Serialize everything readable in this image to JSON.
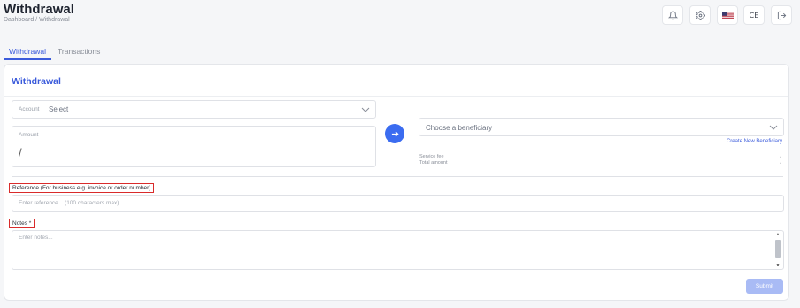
{
  "header": {
    "title": "Withdrawal",
    "breadcrumb": "Dashboard / Withdrawal",
    "lang_code": "CE",
    "icons": [
      "bell-icon",
      "gear-icon",
      "us-flag-icon",
      "language-icon",
      "logout-icon"
    ]
  },
  "tabs": [
    {
      "label": "Withdrawal",
      "active": true
    },
    {
      "label": "Transactions",
      "active": false
    }
  ],
  "form": {
    "title": "Withdrawal",
    "account_label": "Account",
    "account_value": "Select",
    "amount_label": "Amount",
    "amount_currency": "...",
    "amount_value": "/",
    "beneficiary_placeholder": "Choose a beneficiary",
    "create_beneficiary": "Create New Beneficiary",
    "service_fee_label": "Service fee",
    "service_fee_value": "/",
    "total_amount_label": "Total amount",
    "total_amount_value": "/",
    "reference_label": "Reference (For business e.g. invoice or order number)",
    "reference_placeholder": "Enter reference... (100 characters max)",
    "notes_label": "Notes *",
    "notes_placeholder": "Enter notes...",
    "submit_label": "Submit"
  },
  "colors": {
    "accent": "#3b5bdb",
    "arrow_button": "#3b6cf0",
    "highlight": "#d92b2b",
    "submit_disabled": "#a9bbf5"
  }
}
